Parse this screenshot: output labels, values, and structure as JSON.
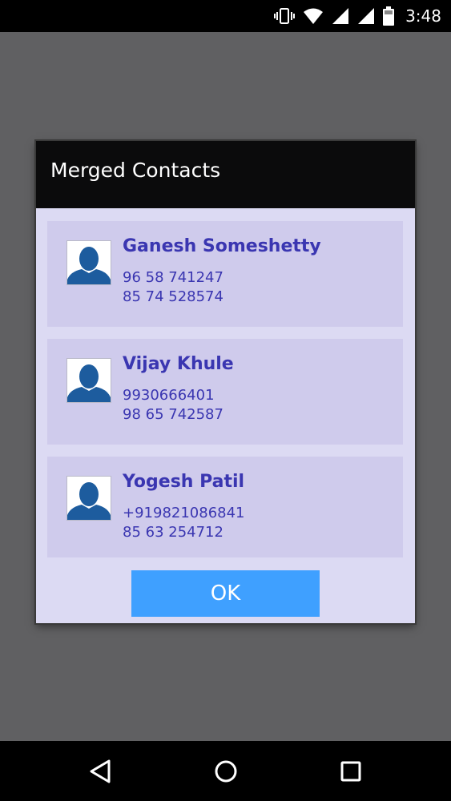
{
  "status_bar": {
    "time": "3:48",
    "icons": [
      "vibrate-icon",
      "wifi-icon",
      "signal-icon",
      "signal-icon",
      "battery-icon"
    ]
  },
  "dialog": {
    "title": "Merged Contacts",
    "ok_label": "OK"
  },
  "contacts": [
    {
      "name": "Ganesh Someshetty",
      "phones": [
        "96 58 741247",
        "85 74 528574"
      ],
      "avatar_icon": "person-silhouette-icon"
    },
    {
      "name": "Vijay Khule",
      "phones": [
        "9930666401",
        "98 65 742587"
      ],
      "avatar_icon": "person-silhouette-icon"
    },
    {
      "name": "Yogesh Patil",
      "phones": [
        "+919821086841",
        "85 63 254712"
      ],
      "avatar_icon": "person-silhouette-icon"
    }
  ],
  "nav_bar": {
    "icons": [
      "back-icon",
      "home-icon",
      "recents-icon"
    ]
  },
  "colors": {
    "scrim": "#606062",
    "dialog_header": "#0b0b0c",
    "dialog_body": "#dcdaf3",
    "card": "#cfcbec",
    "contact_text": "#3a36b1",
    "ok_button": "#3fa0ff",
    "avatar_silhouette": "#1d5c9e"
  }
}
